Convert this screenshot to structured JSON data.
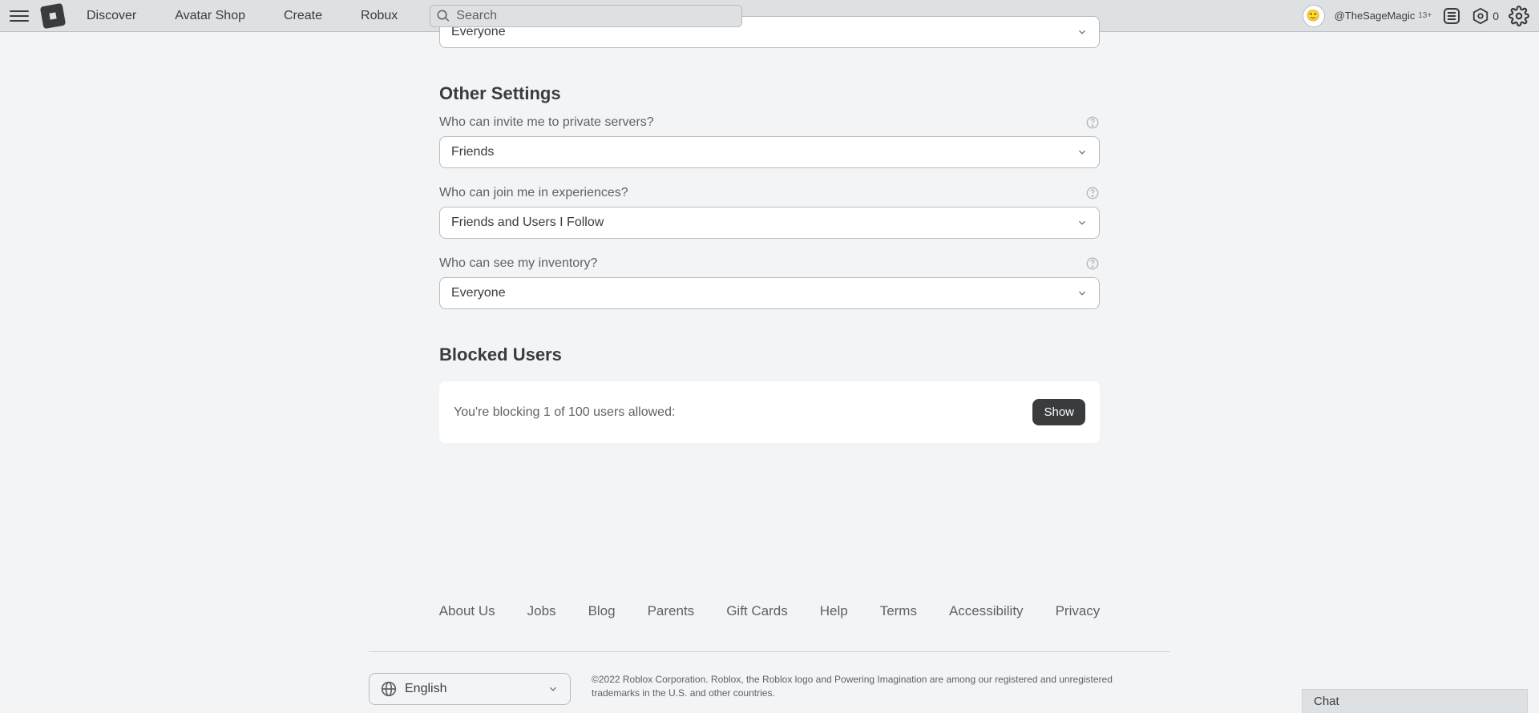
{
  "header": {
    "nav": {
      "discover": "Discover",
      "avatar_shop": "Avatar Shop",
      "create": "Create",
      "robux": "Robux"
    },
    "search_placeholder": "Search",
    "username": "@TheSageMagic",
    "age_label": "13+",
    "robux_amount": "0"
  },
  "main": {
    "prev_select_value": "Everyone",
    "other_settings_title": "Other Settings",
    "settings": [
      {
        "label": "Who can invite me to private servers?",
        "value": "Friends"
      },
      {
        "label": "Who can join me in experiences?",
        "value": "Friends and Users I Follow"
      },
      {
        "label": "Who can see my inventory?",
        "value": "Everyone"
      }
    ],
    "blocked_title": "Blocked Users",
    "blocked_text": "You're blocking 1 of 100 users allowed:",
    "show_btn": "Show"
  },
  "footer": {
    "links": {
      "about": "About Us",
      "jobs": "Jobs",
      "blog": "Blog",
      "parents": "Parents",
      "gift": "Gift Cards",
      "help": "Help",
      "terms": "Terms",
      "accessibility": "Accessibility",
      "privacy": "Privacy"
    },
    "language": "English",
    "copyright": "©2022 Roblox Corporation. Roblox, the Roblox logo and Powering Imagination are among our registered and unregistered trademarks in the U.S. and other countries."
  },
  "chat": {
    "label": "Chat"
  }
}
